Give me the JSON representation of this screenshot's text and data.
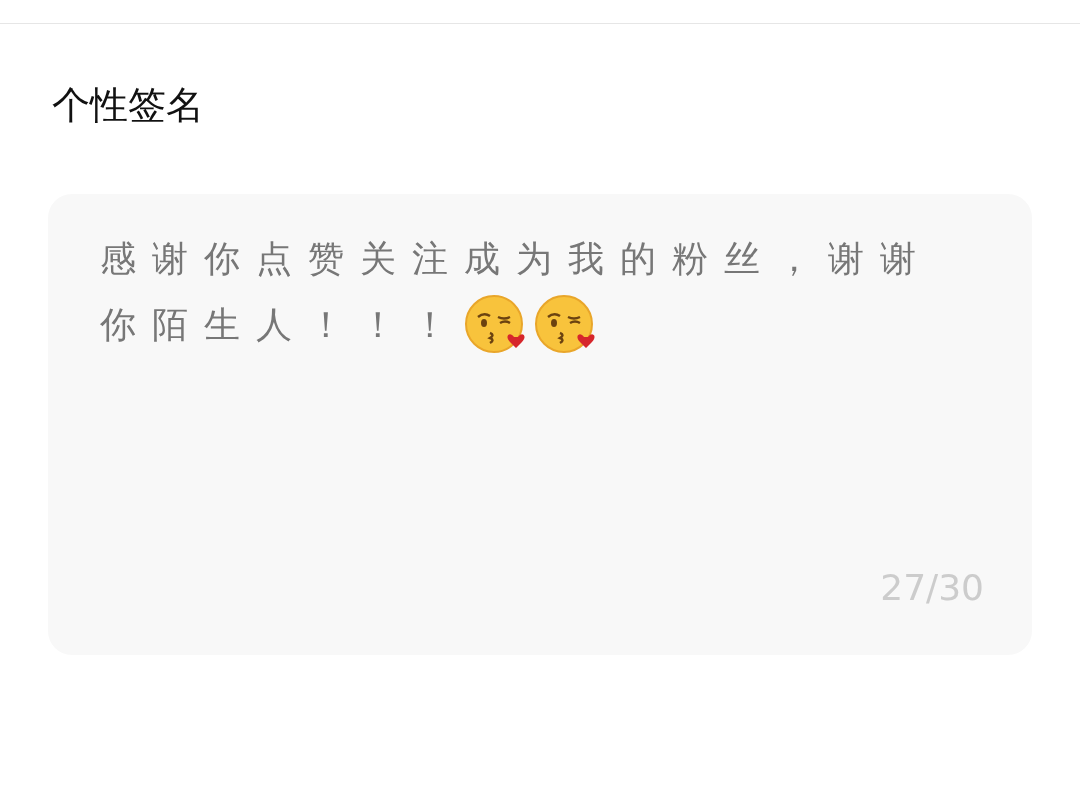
{
  "title": "个性签名",
  "signature": {
    "lines": [
      "感谢你点赞关注成为我的粉丝，谢谢",
      "你陌生人！！！"
    ],
    "counter": "27/30"
  }
}
